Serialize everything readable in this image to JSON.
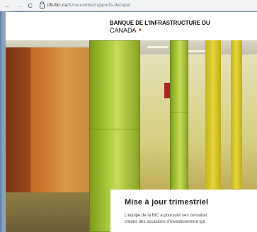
{
  "browser": {
    "back_icon": "arrow-left-icon",
    "back_glyph": "←",
    "forward_icon": "arrow-right-icon",
    "forward_glyph": "→",
    "reload_icon": "reload-icon",
    "reload_glyph": "C",
    "url_host": "cib-bic.ca",
    "url_path": "/fr/nouvelles/rapports-detape/"
  },
  "site": {
    "logo_line1": "BANQUE DE L’INFRASTRUCTURE DU",
    "logo_line2": "CANADA",
    "logo_icon": "maple-leaf-icon",
    "logo_glyph": "✦",
    "accent_color": "#d52b1e"
  },
  "hero_card": {
    "title": "Mise à jour trimestriel",
    "body_line1": "L’équipe de la BIC a poursuivi ses consultat",
    "body_line2": "créons des occasions d’investissement qui"
  }
}
